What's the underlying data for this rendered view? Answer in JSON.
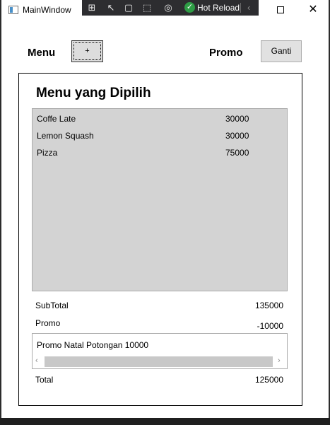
{
  "window": {
    "title": "MainWindow",
    "devtools": {
      "tools": [
        "live-visual-tree-icon",
        "select-element-icon",
        "display-adorners-icon",
        "track-focus-icon",
        "binding-failures-icon"
      ],
      "hot_reload_label": "Hot Reload"
    }
  },
  "toolbar": {
    "menu_label": "Menu",
    "add_button_label": "+",
    "promo_label": "Promo",
    "change_button_label": "Ganti"
  },
  "panel": {
    "title": "Menu yang Dipilih",
    "items": [
      {
        "name": "Coffe Late",
        "price": "30000"
      },
      {
        "name": "Lemon Squash",
        "price": "30000"
      },
      {
        "name": "Pizza",
        "price": "75000"
      }
    ],
    "subtotal_label": "SubTotal",
    "subtotal_value": "135000",
    "promo_label": "Promo",
    "promo_value": "-10000",
    "promo_text": "Promo Natal Potongan 10000",
    "total_label": "Total",
    "total_value": "125000"
  }
}
